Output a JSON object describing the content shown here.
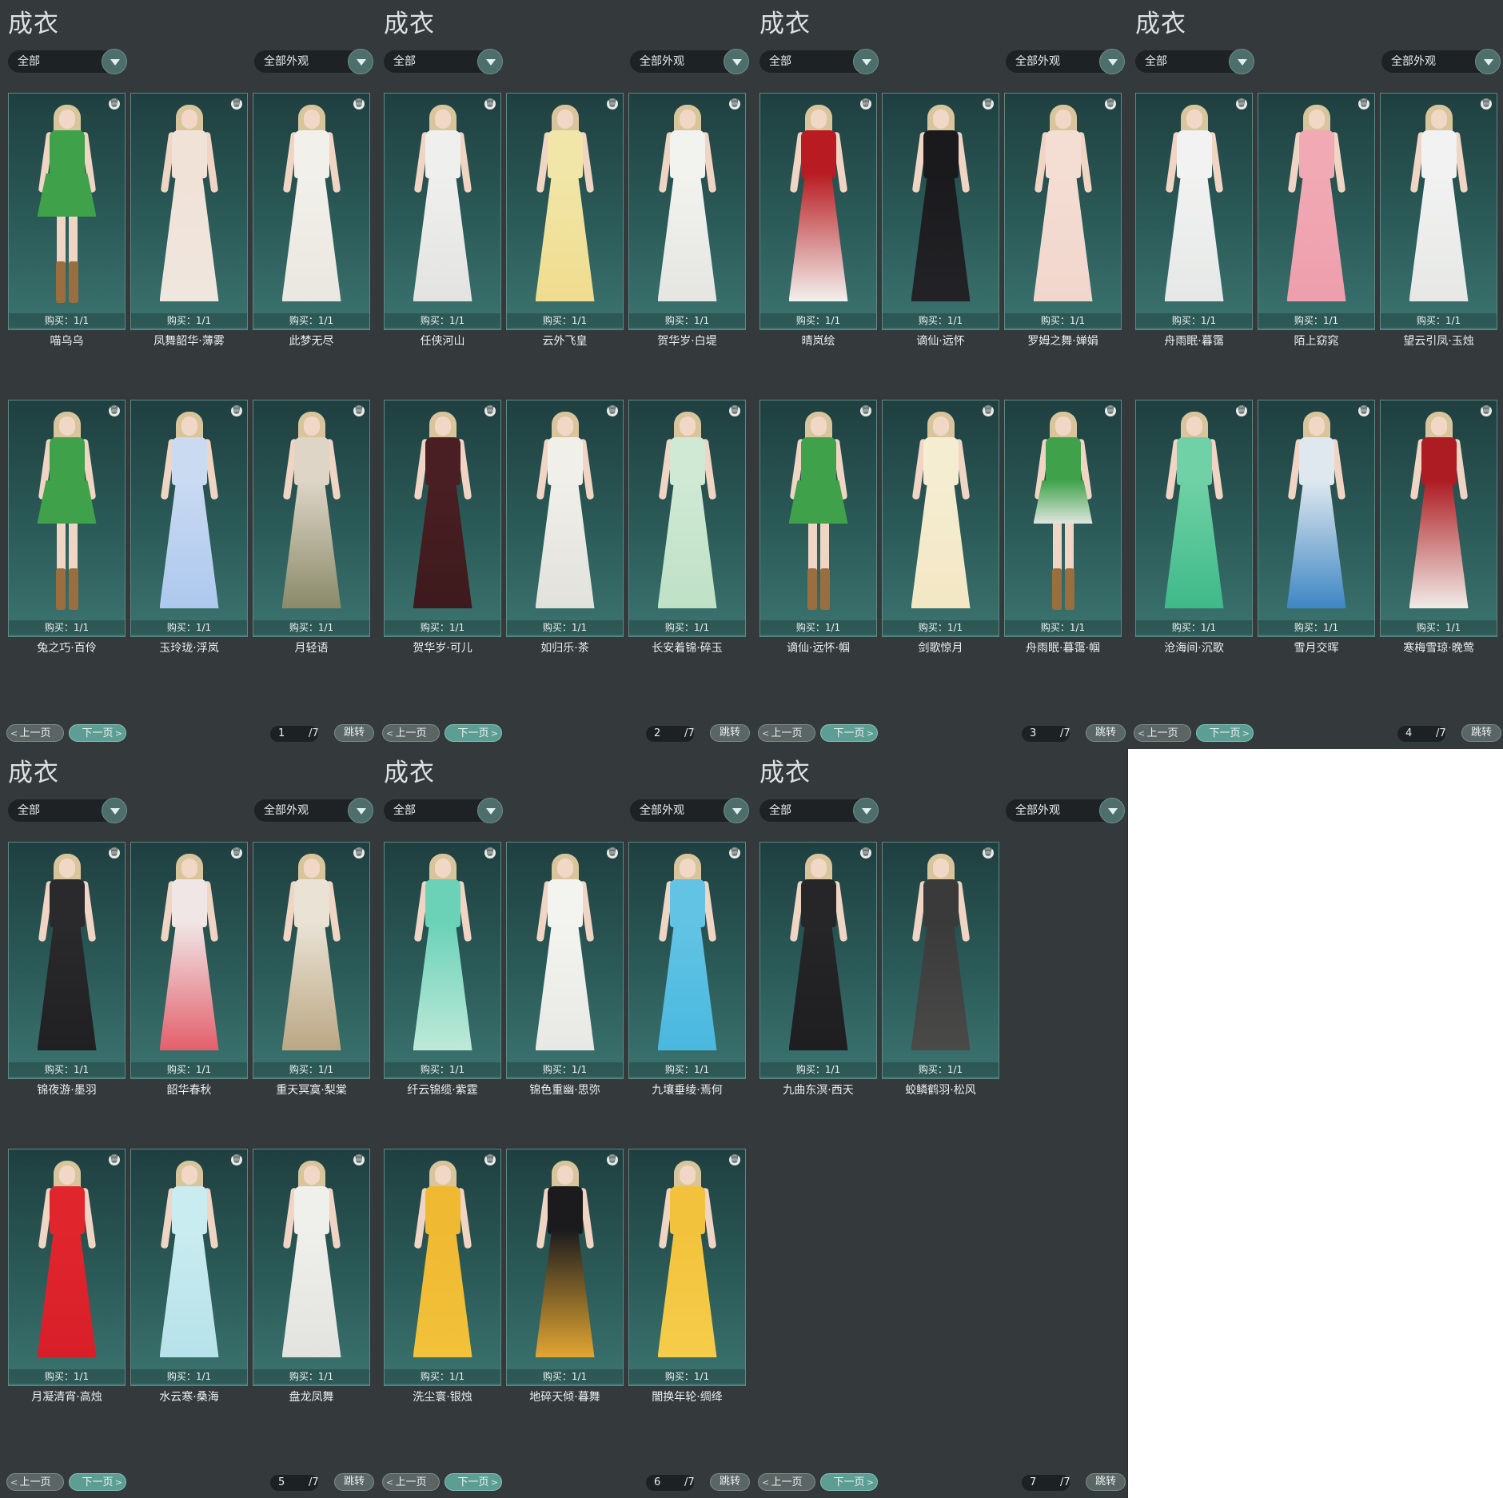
{
  "panels": [
    {
      "title": "成衣",
      "filter_left": "全部",
      "filter_right": "全部外观",
      "page": "1",
      "total": "/7",
      "prev_label": "上一页",
      "next_label": "下一页",
      "jump_label": "跳转",
      "items": [
        {
          "buy": "购买：1/1",
          "name": "喵乌乌",
          "colors": [
            "#3fa24a",
            "#3fa24a"
          ],
          "boots": true
        },
        {
          "buy": "购买：1/1",
          "name": "凤舞韶华·薄雾",
          "colors": [
            "#f1e2d8",
            "#efe6de"
          ]
        },
        {
          "buy": "购买：1/1",
          "name": "此梦无尽",
          "colors": [
            "#f2f0ea",
            "#e9e7df"
          ]
        },
        {
          "buy": "购买：1/1",
          "name": "兔之巧·百伶",
          "colors": [
            "#3fa24a",
            "#3fa24a"
          ],
          "boots": true
        },
        {
          "buy": "购买：1/1",
          "name": "玉玲珑·浮岚",
          "colors": [
            "#c9daf1",
            "#adc8ee"
          ]
        },
        {
          "buy": "购买：1/1",
          "name": "月轻语",
          "colors": [
            "#ded5c6",
            "#8a8a6a"
          ]
        }
      ]
    },
    {
      "title": "成衣",
      "filter_left": "全部",
      "filter_right": "全部外观",
      "page": "2",
      "total": "/7",
      "prev_label": "上一页",
      "next_label": "下一页",
      "jump_label": "跳转",
      "items": [
        {
          "buy": "购买：1/1",
          "name": "任侠河山",
          "colors": [
            "#efefee",
            "#e3e4e2"
          ]
        },
        {
          "buy": "购买：1/1",
          "name": "云外飞皇",
          "colors": [
            "#f1e6a8",
            "#f0dc8e"
          ]
        },
        {
          "buy": "购买：1/1",
          "name": "贺华岁·白堤",
          "colors": [
            "#f2f2ef",
            "#e5e6e2"
          ]
        },
        {
          "buy": "购买：1/1",
          "name": "贺华岁·可儿",
          "colors": [
            "#4a1f23",
            "#3d1a1d"
          ]
        },
        {
          "buy": "购买：1/1",
          "name": "如归乐·茶",
          "colors": [
            "#f0efea",
            "#e2e2dc"
          ]
        },
        {
          "buy": "购买：1/1",
          "name": "长安着锦·碎玉",
          "colors": [
            "#cfe9d4",
            "#bfe1c6"
          ]
        }
      ]
    },
    {
      "title": "成衣",
      "filter_left": "全部",
      "filter_right": "全部外观",
      "page": "3",
      "total": "/7",
      "prev_label": "上一页",
      "next_label": "下一页",
      "jump_label": "跳转",
      "items": [
        {
          "buy": "购买：1/1",
          "name": "晴岚绘",
          "colors": [
            "#b81c22",
            "#f3f1ee"
          ]
        },
        {
          "buy": "购买：1/1",
          "name": "谪仙·远怀",
          "colors": [
            "#1a1a1d",
            "#232327"
          ]
        },
        {
          "buy": "购买：1/1",
          "name": "罗姆之舞·婵娟",
          "colors": [
            "#f4ddd3",
            "#f1d6cc"
          ]
        },
        {
          "buy": "购买：1/1",
          "name": "谪仙·远怀·帼",
          "colors": [
            "#3fa24a",
            "#3fa24a"
          ],
          "boots": true
        },
        {
          "buy": "购买：1/1",
          "name": "剑歌惊月",
          "colors": [
            "#f5edd2",
            "#f3e7c4"
          ]
        },
        {
          "buy": "购买：1/1",
          "name": "舟雨眠·暮霭·帼",
          "colors": [
            "#3fa24a",
            "#dfe5df"
          ],
          "boots": true
        }
      ]
    },
    {
      "title": "成衣",
      "filter_left": "全部",
      "filter_right": "全部外观",
      "page": "4",
      "total": "/7",
      "prev_label": "上一页",
      "next_label": "下一页",
      "jump_label": "跳转",
      "items": [
        {
          "buy": "购买：1/1",
          "name": "舟雨眠·暮霭",
          "colors": [
            "#f1f2f1",
            "#e6e8e7"
          ]
        },
        {
          "buy": "购买：1/1",
          "name": "陌上窈窕",
          "colors": [
            "#f1a9b4",
            "#ee9eac"
          ]
        },
        {
          "buy": "购买：1/1",
          "name": "望云引凤·玉烛",
          "colors": [
            "#f1f2f1",
            "#e7e8e6"
          ]
        },
        {
          "buy": "购买：1/1",
          "name": "沧海间·沉歌",
          "colors": [
            "#6fd1a5",
            "#3fb989"
          ]
        },
        {
          "buy": "购买：1/1",
          "name": "雪月交晖",
          "colors": [
            "#dfe8ef",
            "#3d86c3"
          ]
        },
        {
          "buy": "购买：1/1",
          "name": "寒梅雪琼·晚莺",
          "colors": [
            "#ad1c22",
            "#f1ece8"
          ]
        }
      ]
    },
    {
      "title": "成衣",
      "filter_left": "全部",
      "filter_right": "全部外观",
      "page": "5",
      "total": "/7",
      "prev_label": "上一页",
      "next_label": "下一页",
      "jump_label": "跳转",
      "items": [
        {
          "buy": "购买：1/1",
          "name": "锦夜游·墨羽",
          "colors": [
            "#2a2a2d",
            "#202022"
          ]
        },
        {
          "buy": "购买：1/1",
          "name": "韶华春秋",
          "colors": [
            "#f0e6e6",
            "#e35f6b"
          ]
        },
        {
          "buy": "购买：1/1",
          "name": "重天冥寞·梨棠",
          "colors": [
            "#e9e2d5",
            "#bba783"
          ]
        },
        {
          "buy": "购买：1/1",
          "name": "月凝清宵·高烛",
          "colors": [
            "#e0252d",
            "#d81f29"
          ]
        },
        {
          "buy": "购买：1/1",
          "name": "水云寒·桑海",
          "colors": [
            "#c9ecf0",
            "#b6e2e9"
          ]
        },
        {
          "buy": "购买：1/1",
          "name": "盘龙凤舞",
          "colors": [
            "#efefec",
            "#e2e2de"
          ]
        }
      ]
    },
    {
      "title": "成衣",
      "filter_left": "全部",
      "filter_right": "全部外观",
      "page": "6",
      "total": "/7",
      "prev_label": "上一页",
      "next_label": "下一页",
      "jump_label": "跳转",
      "items": [
        {
          "buy": "购买：1/1",
          "name": "纤云锦缆·紫霆",
          "colors": [
            "#6bd2b8",
            "#bfe9d9"
          ]
        },
        {
          "buy": "购买：1/1",
          "name": "锦色重幽·思弥",
          "colors": [
            "#f3f3f0",
            "#e8e8e4"
          ]
        },
        {
          "buy": "购买：1/1",
          "name": "九壤垂绫·焉何",
          "colors": [
            "#62c3e4",
            "#4ab8df"
          ]
        },
        {
          "buy": "购买：1/1",
          "name": "洗尘寰·银烛",
          "colors": [
            "#f0b932",
            "#f2c23a"
          ]
        },
        {
          "buy": "购买：1/1",
          "name": "地碎天倾·暮舞",
          "colors": [
            "#1b1b1d",
            "#e2a632"
          ]
        },
        {
          "buy": "购买：1/1",
          "name": "闇换年轮·绸绛",
          "colors": [
            "#f3c23c",
            "#f5cd4a"
          ]
        }
      ]
    },
    {
      "title": "成衣",
      "filter_left": "全部",
      "filter_right": "全部外观",
      "page": "7",
      "total": "/7",
      "prev_label": "上一页",
      "next_label": "下一页",
      "jump_label": "跳转",
      "items": [
        {
          "buy": "购买：1/1",
          "name": "九曲东溟·西天",
          "colors": [
            "#262628",
            "#1e1e20"
          ]
        },
        {
          "buy": "购买：1/1",
          "name": "蛟鳞鹤羽·松风",
          "colors": [
            "#3a3a3b",
            "#4a4a49"
          ]
        }
      ]
    }
  ],
  "icons": {
    "trash": "trash-icon",
    "chevron": "chevron-down-icon"
  }
}
